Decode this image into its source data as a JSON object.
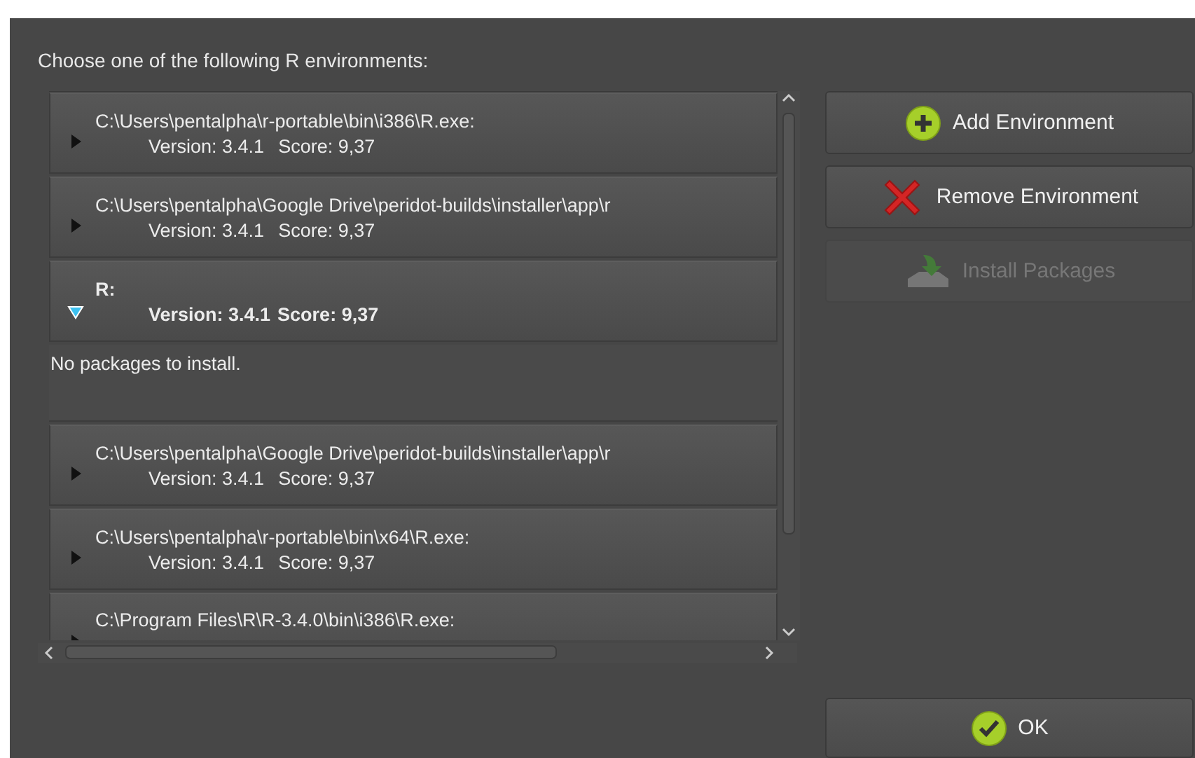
{
  "prompt": "Choose one of the following R environments:",
  "environments": [
    {
      "path": "C:\\Users\\pentalpha\\r-portable\\bin\\i386\\R.exe:",
      "version": "Version: 3.4.1",
      "score": "Score: 9,37",
      "expanded": false
    },
    {
      "path": "C:\\Users\\pentalpha\\Google Drive\\peridot-builds\\installer\\app\\r",
      "version": "Version: 3.4.1",
      "score": "Score: 9,37",
      "expanded": false
    },
    {
      "path": "R:",
      "version": "Version: 3.4.1",
      "score": "Score: 9,37",
      "expanded": true,
      "details": "No packages to install."
    },
    {
      "path": "C:\\Users\\pentalpha\\Google Drive\\peridot-builds\\installer\\app\\r",
      "version": "Version: 3.4.1",
      "score": "Score: 9,37",
      "expanded": false
    },
    {
      "path": "C:\\Users\\pentalpha\\r-portable\\bin\\x64\\R.exe:",
      "version": "Version: 3.4.1",
      "score": "Score: 9,37",
      "expanded": false
    },
    {
      "path": "C:\\Program Files\\R\\R-3.4.0\\bin\\i386\\R.exe:",
      "expanded": false
    }
  ],
  "actions": [
    {
      "label": "Add Environment",
      "kind": "add",
      "disabled": false
    },
    {
      "label": "Remove Environment",
      "kind": "remove",
      "disabled": false
    },
    {
      "label": "Install Packages",
      "kind": "install",
      "disabled": true
    }
  ],
  "ok_button": {
    "label": "OK",
    "kind": "ok",
    "disabled": false
  }
}
